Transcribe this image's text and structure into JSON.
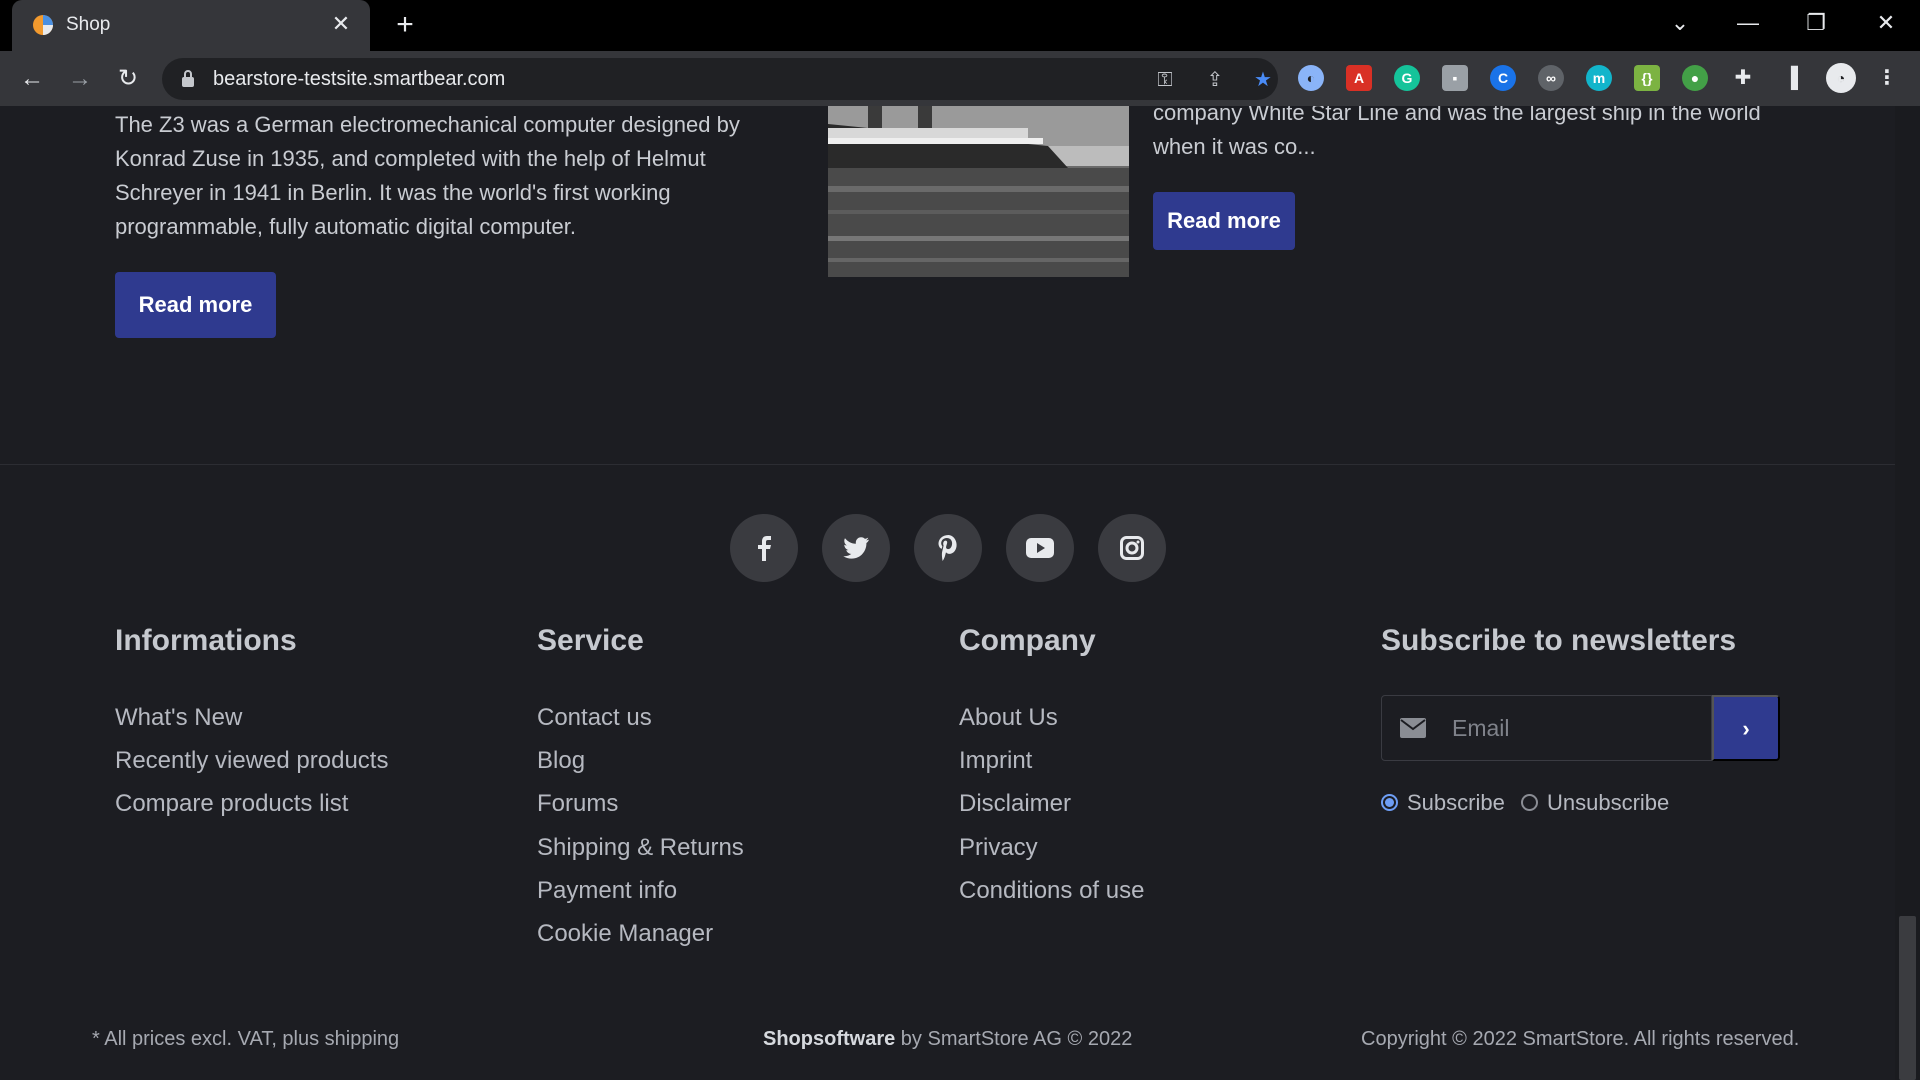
{
  "browser": {
    "tab_title": "Shop",
    "url": "bearstore-testsite.smartbear.com"
  },
  "articles": [
    {
      "excerpt": "The Z3 was a German electromechanical computer designed by Konrad Zuse in 1935, and completed with the help of Helmut Schreyer in 1941 in Berlin. It was the world's first working programmable, fully automatic digital computer.",
      "button": "Read more"
    },
    {
      "excerpt": "company White Star Line and was the largest ship in the world when it was co...",
      "button": "Read more"
    }
  ],
  "social": [
    "facebook-icon",
    "twitter-icon",
    "pinterest-icon",
    "youtube-icon",
    "instagram-icon"
  ],
  "footer": {
    "informations": {
      "title": "Informations",
      "links": [
        "What's New",
        "Recently viewed products",
        "Compare products list"
      ]
    },
    "service": {
      "title": "Service",
      "links": [
        "Contact us",
        "Blog",
        "Forums",
        "Shipping & Returns",
        "Payment info",
        "Cookie Manager"
      ]
    },
    "company": {
      "title": "Company",
      "links": [
        "About Us",
        "Imprint",
        "Disclaimer",
        "Privacy",
        "Conditions of use"
      ]
    },
    "newsletter": {
      "title": "Subscribe to newsletters",
      "email_placeholder": "Email",
      "subscribe_label": "Subscribe",
      "unsubscribe_label": "Unsubscribe",
      "selected": "Subscribe"
    },
    "bottom": {
      "prices_note": "* All prices excl. VAT, plus shipping",
      "brand": "Shopsoftware",
      "brand_suffix": " by SmartStore AG © 2022",
      "copyright": "Copyright © 2022 SmartStore. All rights reserved."
    }
  },
  "colors": {
    "accent": "#2f3a8f",
    "background": "#1c1d22"
  }
}
